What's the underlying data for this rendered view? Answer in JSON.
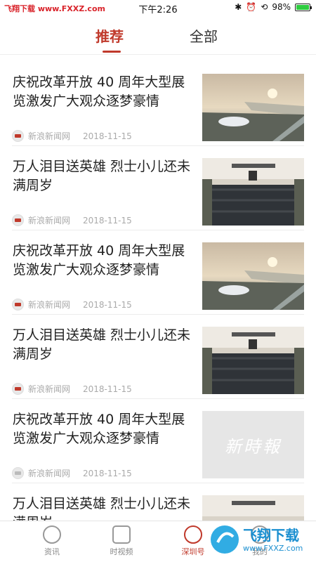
{
  "status": {
    "watermark": "飞翔下载 www.FXXZ.com",
    "time": "下午2:26",
    "battery": "98%",
    "battery_level": 0.98
  },
  "tabs": [
    {
      "label": "推荐"
    },
    {
      "label": "全部"
    }
  ],
  "articles": [
    {
      "title": "庆祝改革开放 40 周年大型展览激发广大观众逐梦豪情",
      "source": "新浪新闻网",
      "date": "2018-11-15",
      "image": "city-aerial"
    },
    {
      "title": "万人泪目送英雄  烈士小儿还未满周岁",
      "source": "新浪新闻网",
      "date": "2018-11-15",
      "image": "memorial-hall"
    },
    {
      "title": "庆祝改革开放 40 周年大型展览激发广大观众逐梦豪情",
      "source": "新浪新闻网",
      "date": "2018-11-15",
      "image": "city-aerial"
    },
    {
      "title": "万人泪目送英雄  烈士小儿还未满周岁",
      "source": "新浪新闻网",
      "date": "2018-11-15",
      "image": "memorial-hall"
    },
    {
      "title": "庆祝改革开放 40 周年大型展览激发广大观众逐梦豪情",
      "source": "新浪新闻网",
      "date": "2018-11-15",
      "image": "newspaper-placeholder",
      "image_text": "新時報"
    },
    {
      "title": "万人泪目送英雄  烈士小儿还未满周岁",
      "source": "",
      "date": "",
      "image": "memorial-hall"
    }
  ],
  "nav": [
    {
      "label": "资讯"
    },
    {
      "label": "时视频"
    },
    {
      "label": "深圳号"
    },
    {
      "label": "我的"
    }
  ],
  "corner_watermark": {
    "line1": "飞翔下载",
    "line2": "www.FXXZ.com"
  },
  "colors": {
    "accent": "#c0392b",
    "text": "#222222",
    "meta": "#aaaaaa"
  }
}
